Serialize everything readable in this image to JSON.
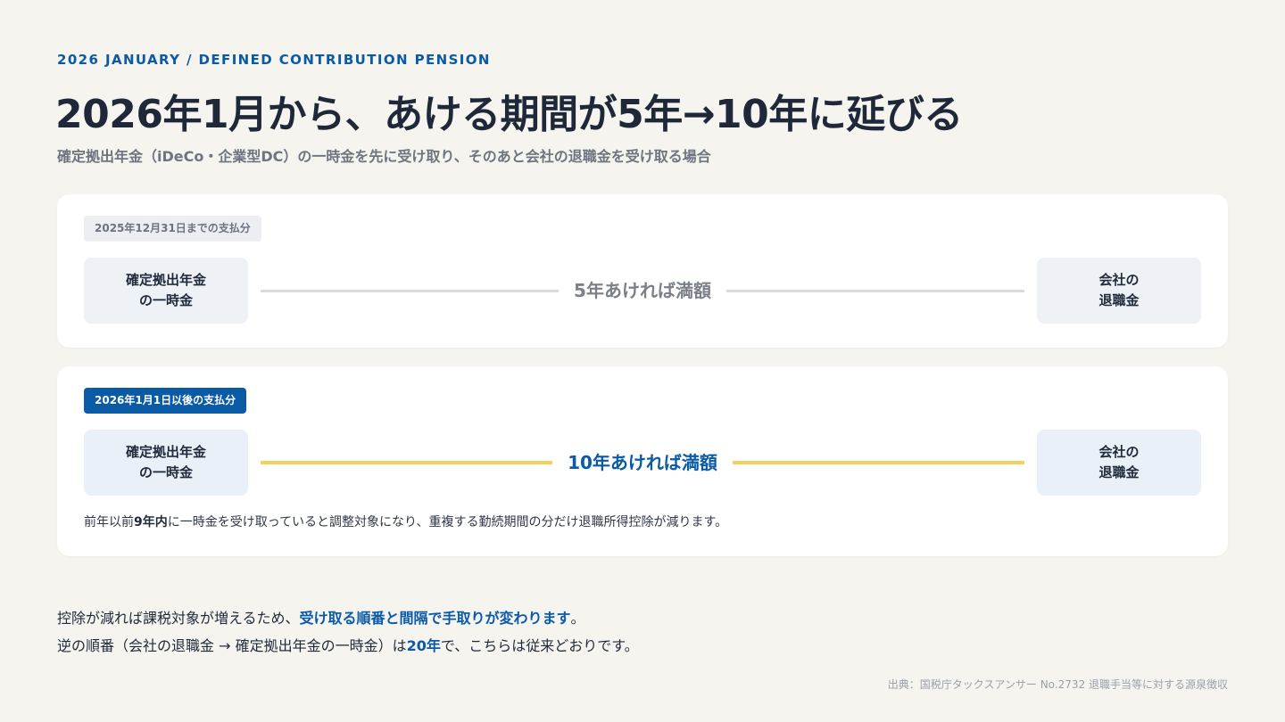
{
  "header": {
    "eyebrow": "2026 JANUARY / DEFINED CONTRIBUTION PENSION",
    "title": "2026年1月から、あける期間が5年→10年に延びる",
    "subtitle": "確定拠出年金（iDeCo・企業型DC）の一時金を先に受け取り、そのあと会社の退職金を受け取る場合"
  },
  "old_rule": {
    "tag": "2025年12月31日までの支払分",
    "left_box": [
      "確定拠出年金",
      "の一時金"
    ],
    "middle_label": "5年あければ満額",
    "right_box": [
      "会社の",
      "退職金"
    ]
  },
  "new_rule": {
    "tag": "2026年1月1日以後の支払分",
    "left_box": [
      "確定拠出年金",
      "の一時金"
    ],
    "middle_label": "10年あければ満額",
    "right_box": [
      "会社の",
      "退職金"
    ],
    "note": {
      "before": "前年以前",
      "bold": "9年内",
      "after": "に一時金を受け取っていると調整対象になり、重複する勤続期間の分だけ退職所得控除が減ります。"
    }
  },
  "summary": {
    "line1_before": "控除が減れば課税対象が増えるため、",
    "line1_highlight": "受け取る順番と間隔で手取りが変わります",
    "line1_after": "。",
    "line2_before": "逆の順番（会社の退職金 → 確定拠出年金の一時金）は",
    "line2_highlight": "20年",
    "line2_after": "で、こちらは従来どおりです。"
  },
  "source": "出典：国税庁タックスアンサー No.2732 退職手当等に対する源泉徴収",
  "colors": {
    "accent": "#0a5aa6",
    "highlight_line": "#f7cf5c",
    "background": "#f5f4ef"
  }
}
